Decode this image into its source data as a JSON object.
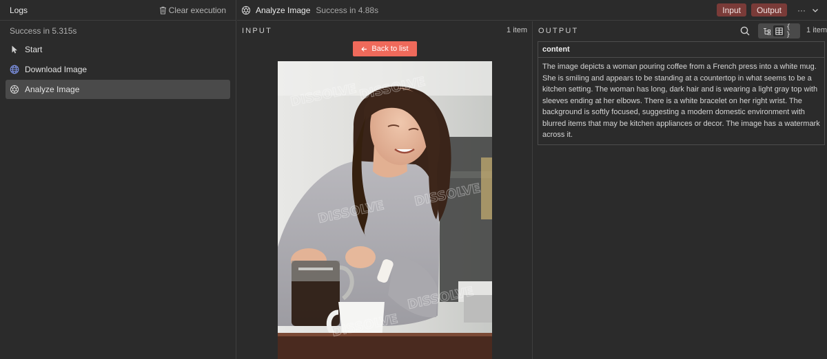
{
  "logs": {
    "title": "Logs",
    "clear_label": "Clear execution",
    "status": "Success in 5.315s",
    "items": [
      {
        "label": "Start",
        "icon": "cursor-icon",
        "active": false
      },
      {
        "label": "Download Image",
        "icon": "globe-icon",
        "active": false
      },
      {
        "label": "Analyze Image",
        "icon": "openai-icon",
        "active": true
      }
    ]
  },
  "header": {
    "node_name": "Analyze Image",
    "node_status": "Success in 4.88s",
    "input_pill": "Input",
    "output_pill": "Output",
    "more_label": "···"
  },
  "input": {
    "label": "INPUT",
    "count": "1 item",
    "back_label": "Back to list"
  },
  "output": {
    "label": "OUTPUT",
    "count": "1 item",
    "view_json": "{ }",
    "column": "content",
    "content": "The image depicts a woman pouring coffee from a French press into a white mug. She is smiling and appears to be standing at a countertop in what seems to be a kitchen setting. The woman has long, dark hair and is wearing a light gray top with sleeves ending at her elbows. There is a white bracelet on her right wrist. The background is softly focused, suggesting a modern domestic environment with blurred items that may be kitchen appliances or decor. The image has a watermark across it."
  },
  "colors": {
    "background": "#2b2b2b",
    "accent_button": "#ef6a5b",
    "pill": "#7a3b38",
    "active_item": "#4a4a4a"
  }
}
